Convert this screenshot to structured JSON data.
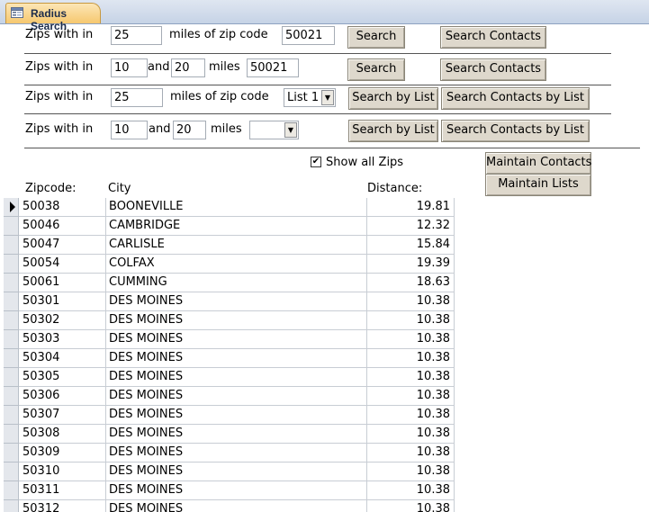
{
  "window": {
    "tab_title": "Radius Search"
  },
  "row1": {
    "label1": "Zips with in",
    "miles": "25",
    "label2": "miles of zip code",
    "zip": "50021",
    "search": "Search",
    "search_contacts": "Search Contacts"
  },
  "row2": {
    "label1": "Zips with in",
    "min": "10",
    "and": "and",
    "max": "20",
    "label2": "miles",
    "zip": "50021",
    "search": "Search",
    "search_contacts": "Search Contacts"
  },
  "row3": {
    "label1": "Zips with in",
    "miles": "25",
    "label2": "miles of zip code",
    "list": "List 1",
    "search": "Search by List",
    "search_contacts": "Search Contacts by List"
  },
  "row4": {
    "label1": "Zips with in",
    "min": "10",
    "and": "and",
    "max": "20",
    "label2": "miles",
    "list": "",
    "search": "Search by List",
    "search_contacts": "Search Contacts by List"
  },
  "options": {
    "show_all_label": "Show all Zips",
    "show_all_checked": true,
    "maintain_contacts": "Maintain Contacts",
    "maintain_lists": "Maintain Lists"
  },
  "table": {
    "headers": {
      "zip": "Zipcode:",
      "city": "City",
      "distance": "Distance:"
    },
    "rows": [
      {
        "zip": "50038",
        "city": "BOONEVILLE",
        "distance": "19.81"
      },
      {
        "zip": "50046",
        "city": "CAMBRIDGE",
        "distance": "12.32"
      },
      {
        "zip": "50047",
        "city": "CARLISLE",
        "distance": "15.84"
      },
      {
        "zip": "50054",
        "city": "COLFAX",
        "distance": "19.39"
      },
      {
        "zip": "50061",
        "city": "CUMMING",
        "distance": "18.63"
      },
      {
        "zip": "50301",
        "city": "DES MOINES",
        "distance": "10.38"
      },
      {
        "zip": "50302",
        "city": "DES MOINES",
        "distance": "10.38"
      },
      {
        "zip": "50303",
        "city": "DES MOINES",
        "distance": "10.38"
      },
      {
        "zip": "50304",
        "city": "DES MOINES",
        "distance": "10.38"
      },
      {
        "zip": "50305",
        "city": "DES MOINES",
        "distance": "10.38"
      },
      {
        "zip": "50306",
        "city": "DES MOINES",
        "distance": "10.38"
      },
      {
        "zip": "50307",
        "city": "DES MOINES",
        "distance": "10.38"
      },
      {
        "zip": "50308",
        "city": "DES MOINES",
        "distance": "10.38"
      },
      {
        "zip": "50309",
        "city": "DES MOINES",
        "distance": "10.38"
      },
      {
        "zip": "50310",
        "city": "DES MOINES",
        "distance": "10.38"
      },
      {
        "zip": "50311",
        "city": "DES MOINES",
        "distance": "10.38"
      },
      {
        "zip": "50312",
        "city": "DES MOINES",
        "distance": "10.38"
      }
    ]
  }
}
